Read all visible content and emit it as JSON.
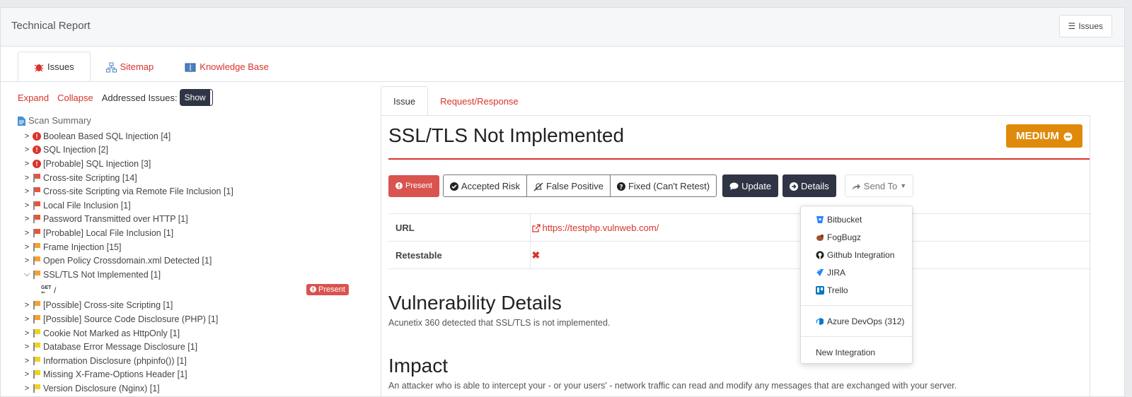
{
  "header": {
    "title": "Technical Report",
    "issues_button": "Issues"
  },
  "top_tabs": [
    {
      "label": "Issues",
      "icon": "bug-icon",
      "active": true
    },
    {
      "label": "Sitemap",
      "icon": "sitemap-icon",
      "active": false
    },
    {
      "label": "Knowledge Base",
      "icon": "book-icon",
      "active": false
    }
  ],
  "controls": {
    "expand": "Expand",
    "collapse": "Collapse",
    "addressed_label": "Addressed Issues:",
    "show": "Show"
  },
  "scan_summary": "Scan Summary",
  "tree": [
    {
      "label": "Boolean Based SQL Injection [4]",
      "severity": "critical",
      "expanded": false
    },
    {
      "label": "SQL Injection [2]",
      "severity": "critical",
      "expanded": false
    },
    {
      "label": "[Probable] SQL Injection [3]",
      "severity": "critical",
      "expanded": false
    },
    {
      "label": "Cross-site Scripting [14]",
      "severity": "high",
      "expanded": false
    },
    {
      "label": "Cross-site Scripting via Remote File Inclusion [1]",
      "severity": "high",
      "expanded": false
    },
    {
      "label": "Local File Inclusion [1]",
      "severity": "high",
      "expanded": false
    },
    {
      "label": "Password Transmitted over HTTP [1]",
      "severity": "high",
      "expanded": false
    },
    {
      "label": "[Probable] Local File Inclusion [1]",
      "severity": "high",
      "expanded": false
    },
    {
      "label": "Frame Injection [15]",
      "severity": "medium",
      "expanded": false
    },
    {
      "label": "Open Policy Crossdomain.xml Detected [1]",
      "severity": "medium",
      "expanded": false
    },
    {
      "label": "SSL/TLS Not Implemented [1]",
      "severity": "medium",
      "expanded": true
    },
    {
      "label": "[Possible] Cross-site Scripting [1]",
      "severity": "medium",
      "expanded": false
    },
    {
      "label": "[Possible] Source Code Disclosure (PHP) [1]",
      "severity": "medium",
      "expanded": false
    },
    {
      "label": "Cookie Not Marked as HttpOnly [1]",
      "severity": "low",
      "expanded": false
    },
    {
      "label": "Database Error Message Disclosure [1]",
      "severity": "low",
      "expanded": false
    },
    {
      "label": "Information Disclosure (phpinfo()) [1]",
      "severity": "low",
      "expanded": false
    },
    {
      "label": "Missing X-Frame-Options Header [1]",
      "severity": "low",
      "expanded": false
    },
    {
      "label": "Version Disclosure (Nginx) [1]",
      "severity": "low",
      "expanded": false
    }
  ],
  "child": {
    "method": "GET",
    "path": "/",
    "status": "Present"
  },
  "inner_tabs": [
    "Issue",
    "Request/Response"
  ],
  "issue": {
    "title": "SSL/TLS Not Implemented",
    "severity": "MEDIUM",
    "actions": {
      "present": "Present",
      "accepted_risk": "Accepted Risk",
      "false_positive": "False Positive",
      "fixed": "Fixed (Can't Retest)",
      "update": "Update",
      "details": "Details",
      "send_to": "Send To"
    },
    "url_label": "URL",
    "url_value": "https://testphp.vulnweb.com/",
    "retestable_label": "Retestable",
    "retestable_value": "✖",
    "details_title": "Vulnerability Details",
    "details_text": "Acunetix 360 detected that SSL/TLS is not implemented.",
    "impact_title": "Impact",
    "impact_text": "An attacker who is able to intercept your - or your users' - network traffic can read and modify any messages that are exchanged with your server."
  },
  "send_to_menu": {
    "items": [
      "Bitbucket",
      "FogBugz",
      "Github Integration",
      "JIRA",
      "Trello"
    ],
    "azure": "Azure DevOps (312)",
    "new": "New Integration"
  },
  "colors": {
    "accent": "#d9322b",
    "dark_button": "#2f3545",
    "medium": "#e08a0b",
    "critical": "#d9322b",
    "high_flag": "#e8543d",
    "medium_flag": "#f6a12c",
    "low_flag": "#f3d21c"
  }
}
